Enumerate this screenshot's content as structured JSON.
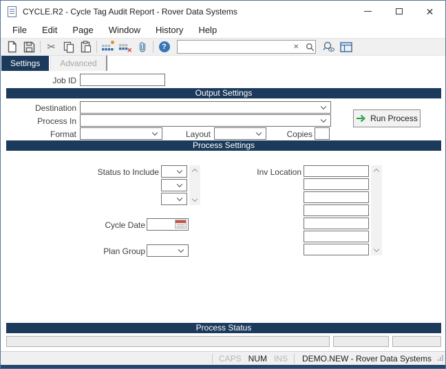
{
  "window": {
    "title": "CYCLE.R2 - Cycle Tag Audit Report - Rover Data Systems",
    "close_glyph": "✕"
  },
  "menu": {
    "items": [
      "File",
      "Edit",
      "Page",
      "Window",
      "History",
      "Help"
    ]
  },
  "toolbar": {
    "cut_glyph": "✂",
    "help_glyph": "?",
    "grid_delete_glyph": "✕",
    "search": {
      "value": "",
      "clear_glyph": "✕"
    }
  },
  "tabs": {
    "settings": "Settings",
    "advanced": "Advanced"
  },
  "form": {
    "job_id": {
      "label": "Job ID",
      "value": ""
    },
    "output": {
      "header": "Output Settings",
      "destination_label": "Destination",
      "process_in_label": "Process In",
      "format_label": "Format",
      "layout_label": "Layout",
      "copies_label": "Copies",
      "run_button": "Run Process"
    },
    "process": {
      "header": "Process Settings",
      "status_to_include_label": "Status to Include",
      "inv_location_label": "Inv Location",
      "cycle_date_label": "Cycle Date",
      "plan_group_label": "Plan Group"
    },
    "status_section": {
      "header": "Process Status"
    }
  },
  "statusbar": {
    "caps": "CAPS",
    "num": "NUM",
    "ins": "INS",
    "session": "DEMO.NEW - Rover Data Systems"
  },
  "colors": {
    "accent_navy": "#1B3A5C",
    "frame_blue": "#54749E",
    "green_arrow": "#1F9D3F"
  }
}
